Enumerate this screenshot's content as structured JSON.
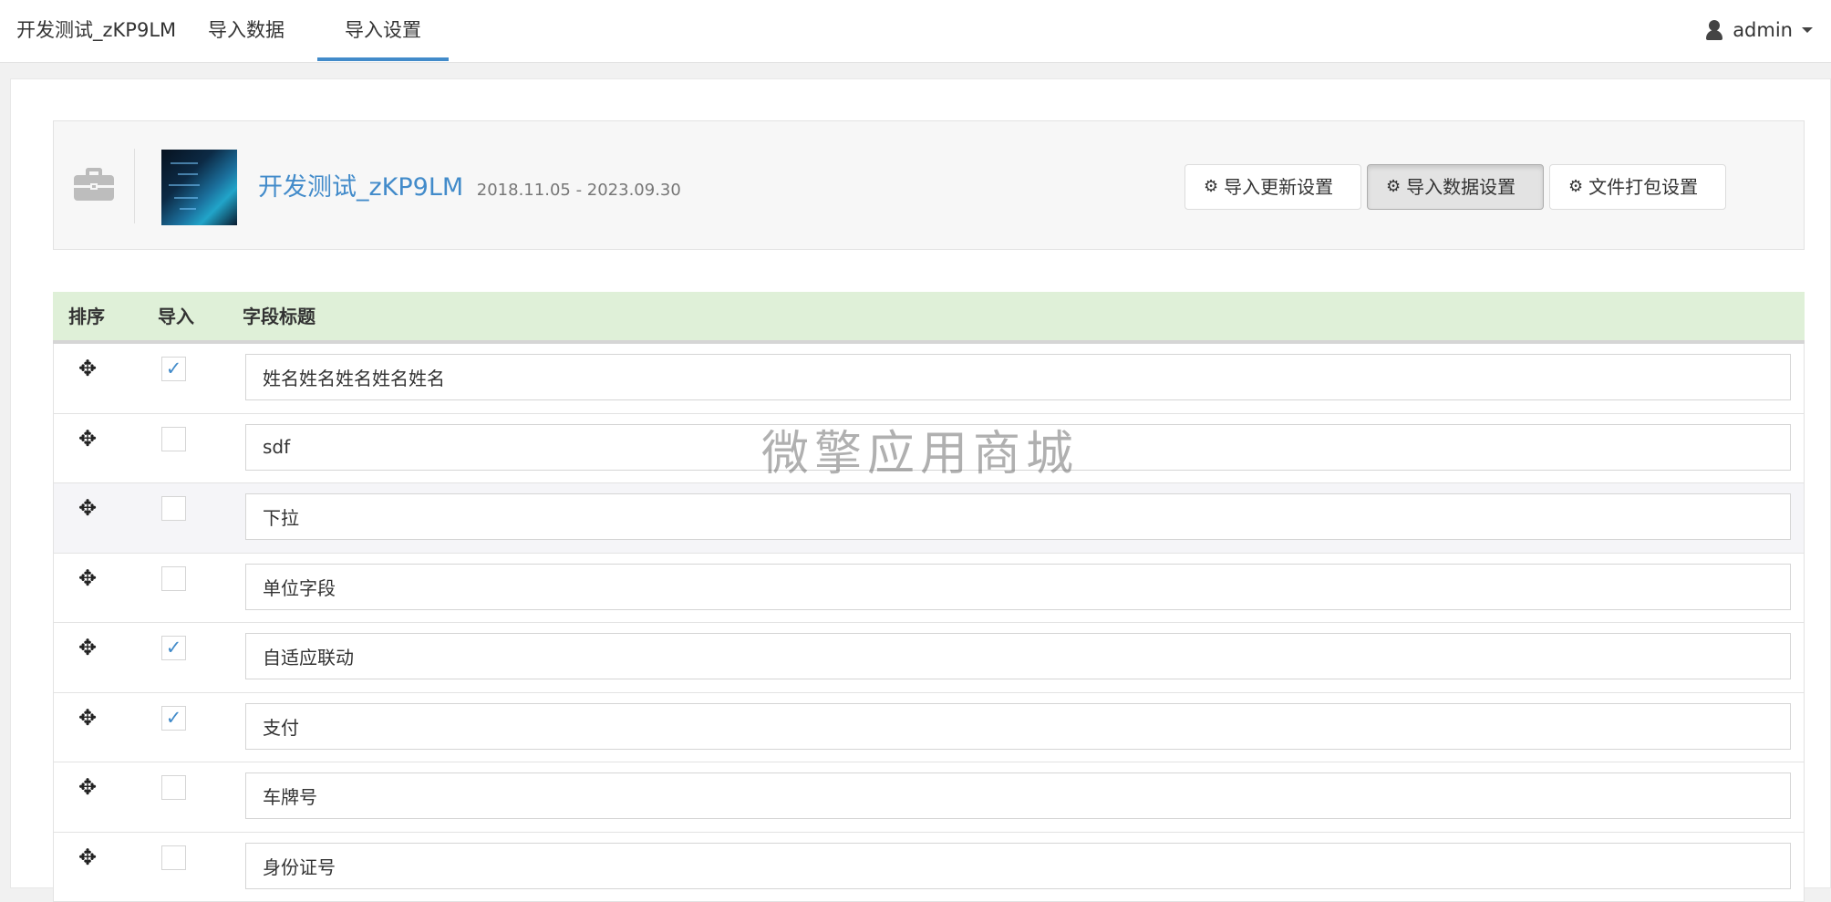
{
  "navbar": {
    "brand": "开发测试_zKP9LM",
    "tabs": [
      {
        "label": "导入数据"
      },
      {
        "label": "导入设置"
      }
    ],
    "user": {
      "name": "admin"
    }
  },
  "app": {
    "title": "开发测试_zKP9LM",
    "dates": "2018.11.05 - 2023.09.30",
    "buttons": {
      "import_update": "导入更新设置",
      "import_data": "导入数据设置",
      "file_pack": "文件打包设置"
    }
  },
  "table": {
    "headers": {
      "sort": "排序",
      "import": "导入",
      "title": "字段标题"
    },
    "rows": [
      {
        "title": "姓名姓名姓名姓名姓名",
        "checked": true,
        "check": "✓"
      },
      {
        "title": "sdf",
        "checked": false,
        "check": ""
      },
      {
        "title": "下拉",
        "checked": false,
        "check": ""
      },
      {
        "title": "单位字段",
        "checked": false,
        "check": ""
      },
      {
        "title": "自适应联动",
        "checked": true,
        "check": "✓"
      },
      {
        "title": "支付",
        "checked": true,
        "check": "✓"
      },
      {
        "title": "车牌号",
        "checked": false,
        "check": ""
      },
      {
        "title": "身份证号",
        "checked": false,
        "check": ""
      }
    ]
  },
  "watermark": "微擎应用商城",
  "icons": {
    "user": "user-icon",
    "briefcase": "briefcase-icon",
    "cogs": "cogs-icon",
    "move": "move-icon",
    "caret": "caret-down-icon"
  },
  "colors": {
    "accent": "#428bca",
    "header_row": "#dff0d8",
    "active_button": "#e3e3e3"
  }
}
